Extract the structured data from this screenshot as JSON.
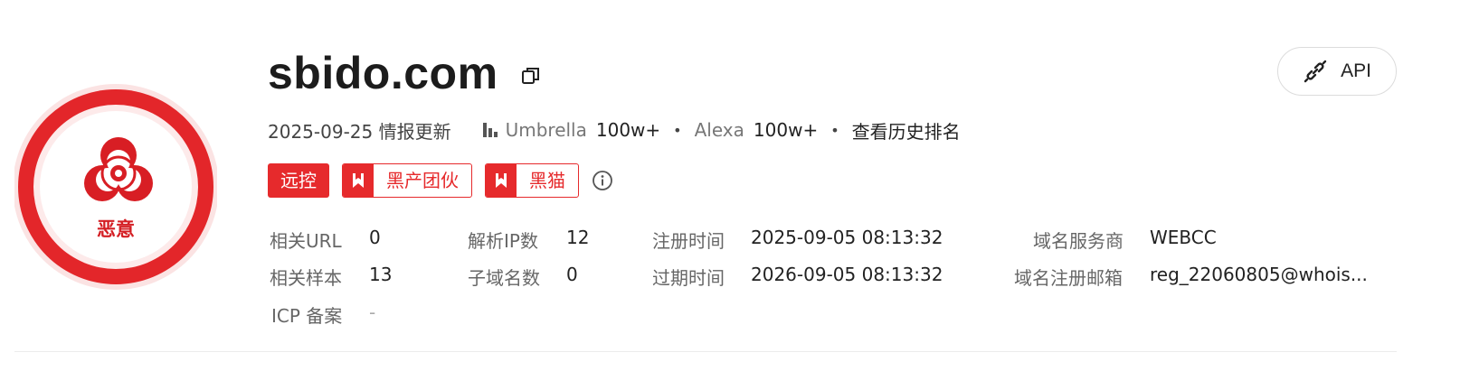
{
  "badge": {
    "label": "恶意",
    "icon": "biohazard-icon",
    "color": "#e3262a"
  },
  "domain": {
    "name": "sbido.com",
    "copy_icon": "copy-icon"
  },
  "api_button": {
    "label": "API",
    "icon": "link-icon"
  },
  "meta": {
    "update": "2025-09-25 情报更新",
    "rank_icon": "bar-chart-icon",
    "umbrella_label": "Umbrella",
    "umbrella_value": "100w+",
    "alexa_label": "Alexa",
    "alexa_value": "100w+",
    "separator": "•",
    "history_link": "查看历史排名"
  },
  "tags": [
    {
      "label": "远控",
      "style": "solid"
    },
    {
      "label": "黑产团伙",
      "style": "outline",
      "icon": "bookmark-icon"
    },
    {
      "label": "黑猫",
      "style": "outline",
      "icon": "bookmark-icon"
    }
  ],
  "info_icon": "info-icon",
  "details": {
    "related_url": {
      "label": "相关URL",
      "value": "0"
    },
    "related_sample": {
      "label": "相关样本",
      "value": "13"
    },
    "icp": {
      "label": "ICP 备案",
      "value": "-"
    },
    "resolved_ip": {
      "label": "解析IP数",
      "value": "12"
    },
    "subdomain": {
      "label": "子域名数",
      "value": "0"
    },
    "reg_time": {
      "label": "注册时间",
      "value": "2025-09-05 08:13:32"
    },
    "expire_time": {
      "label": "过期时间",
      "value": "2026-09-05 08:13:32"
    },
    "registrar": {
      "label": "域名服务商",
      "value": "WEBCC"
    },
    "reg_email": {
      "label": "域名注册邮箱",
      "value": "reg_22060805@whois..."
    }
  },
  "colors": {
    "accent_red": "#e62a2c",
    "text": "#222222",
    "muted": "#666666"
  }
}
